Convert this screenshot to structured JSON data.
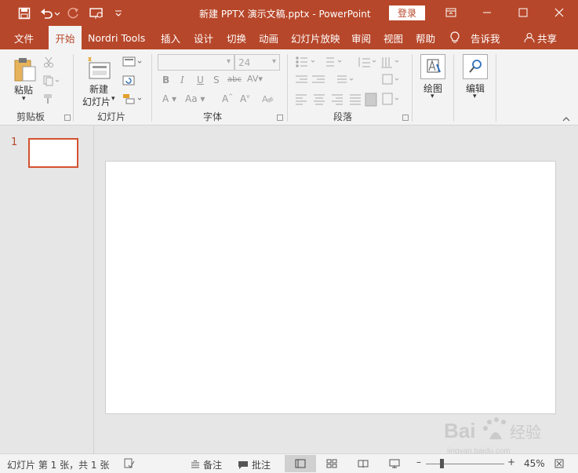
{
  "window": {
    "title": "新建 PPTX 演示文稿.pptx  -  PowerPoint",
    "login_label": "登录"
  },
  "quick_access": {
    "save": "save-icon",
    "undo": "undo-icon",
    "redo": "redo-icon",
    "present": "present-from-start-icon",
    "customize": "customize-qat-icon"
  },
  "tabs": [
    "文件",
    "开始",
    "Nordri Tools",
    "插入",
    "设计",
    "切换",
    "动画",
    "幻灯片放映",
    "审阅",
    "视图",
    "帮助"
  ],
  "active_tab": "开始",
  "tell_me": "告诉我",
  "share": "共享",
  "ribbon": {
    "clipboard": {
      "paste": "粘贴",
      "group": "剪贴板"
    },
    "slides": {
      "new_slide_1": "新建",
      "new_slide_2": "幻灯片",
      "group": "幻灯片"
    },
    "font": {
      "size": "24",
      "bold": "B",
      "italic": "I",
      "underline": "U",
      "shadow": "S",
      "strike": "abc",
      "group": "字体"
    },
    "paragraph": {
      "group": "段落"
    },
    "drawing": {
      "label": "绘图"
    },
    "editing": {
      "label": "编辑"
    }
  },
  "thumbnail": {
    "number": "1"
  },
  "status": {
    "slide_info": "幻灯片 第 1 张，共 1 张",
    "notes": "备注",
    "comments": "批注",
    "zoom": "45%"
  },
  "watermark": {
    "brand": "Bai",
    "brand2": "经验",
    "url": "jingyan.baidu.com"
  },
  "colors": {
    "accent": "#b7472a",
    "ribbon_bg": "#f3f3f3",
    "workspace": "#e6e6e6"
  }
}
